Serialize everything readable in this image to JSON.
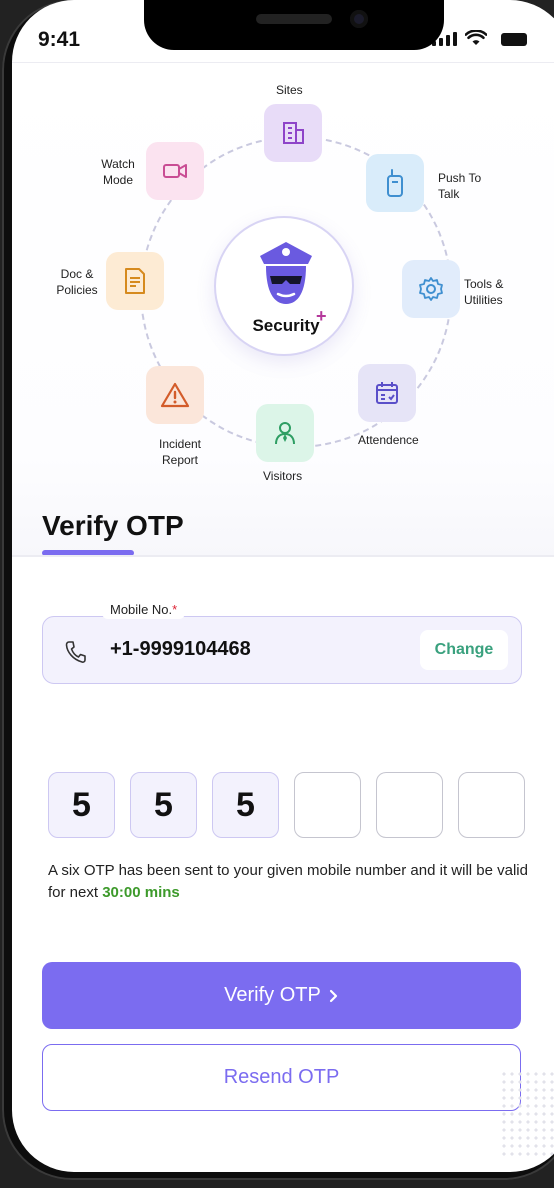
{
  "status": {
    "time": "9:41"
  },
  "hero": {
    "center_label": "Security",
    "center_badge": "+",
    "modules": [
      {
        "label": "Sites",
        "icon": "building-icon",
        "color": "#e8dcf8"
      },
      {
        "label": "Push To Talk",
        "icon": "walkie-talkie-icon",
        "color": "#d9ecfa"
      },
      {
        "label": "Tools & Utilities",
        "icon": "gear-icon",
        "color": "#e1ecfb"
      },
      {
        "label": "Attendence",
        "icon": "calendar-icon",
        "color": "#e6e4f7"
      },
      {
        "label": "Visitors",
        "icon": "visitor-icon",
        "color": "#dcf5e8"
      },
      {
        "label": "Incident Report",
        "icon": "warning-icon",
        "color": "#fbe6da"
      },
      {
        "label": "Doc & Policies",
        "icon": "document-icon",
        "color": "#fdebd4"
      },
      {
        "label": "Watch Mode",
        "icon": "video-camera-icon",
        "color": "#fbe3f0"
      }
    ]
  },
  "page": {
    "title": "Verify OTP"
  },
  "mobile": {
    "label": "Mobile No.",
    "required_mark": "*",
    "value": "+1-9999104468",
    "change_label": "Change"
  },
  "otp": {
    "digits": [
      "5",
      "5",
      "5",
      "",
      "",
      ""
    ],
    "note": "A six OTP has been sent to your given mobile number and it will be valid for next",
    "timer": "30:00 mins"
  },
  "actions": {
    "verify_label": "Verify OTP",
    "resend_label": "Resend OTP"
  },
  "colors": {
    "accent": "#7b6cf0",
    "success": "#3d9a2b",
    "change_text": "#3aa17e"
  }
}
